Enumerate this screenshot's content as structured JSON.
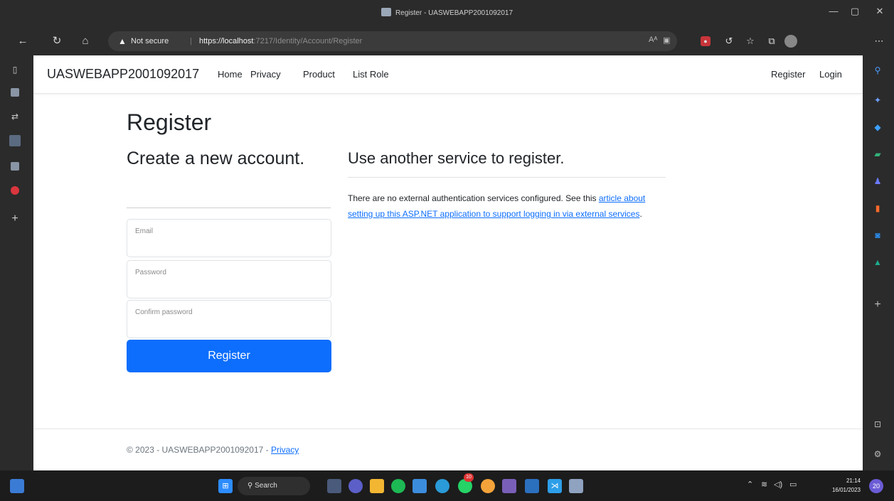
{
  "window": {
    "title": "Register - UASWEBAPP2001092017",
    "minimize": "—",
    "maximize": "▢",
    "close": "✕"
  },
  "addressbar": {
    "back": "←",
    "refresh": "↻",
    "home": "⌂",
    "security_label": "Not secure",
    "url_host": "https://localhost",
    "url_rest": ":7217/Identity/Account/Register",
    "more": "⋯"
  },
  "navbar": {
    "brand": "UASWEBAPP2001092017",
    "links": [
      "Home",
      "Privacy",
      "Product",
      "List Role"
    ],
    "right_links": [
      "Register",
      "Login"
    ]
  },
  "register": {
    "heading": "Register",
    "subheading": "Create a new account.",
    "email_placeholder": "Email",
    "password_placeholder": "Password",
    "confirm_placeholder": "Confirm password",
    "submit_label": "Register"
  },
  "external": {
    "heading": "Use another service to register.",
    "text_before": "There are no external authentication services configured. See this ",
    "link_text": "article about setting up this ASP.NET application to support logging in via external services",
    "text_after": "."
  },
  "footer": {
    "text": "© 2023 - UASWEBAPP2001092017 - ",
    "privacy_link": "Privacy"
  },
  "taskbar": {
    "search_label": "Search",
    "time": "21:14",
    "date": "16/01/2023",
    "notification_count": "20",
    "whatsapp_badge": "10"
  },
  "colors": {
    "primary": "#0d6efd",
    "chrome": "#2b2b2b",
    "taskbar": "#1c1c1c"
  }
}
